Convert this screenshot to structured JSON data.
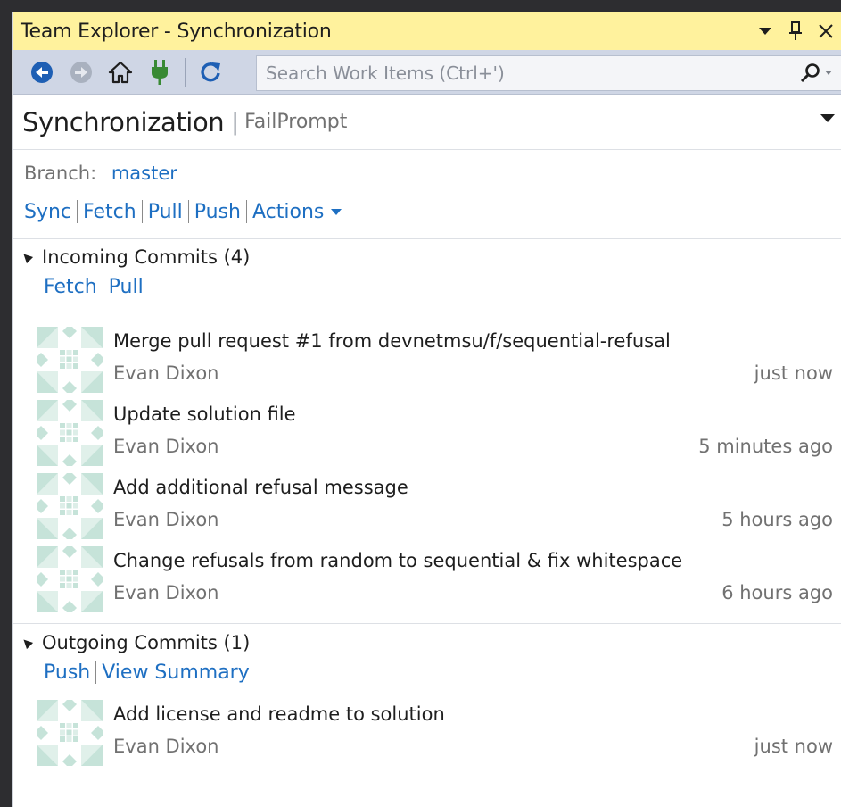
{
  "window": {
    "title": "Team Explorer - Synchronization"
  },
  "toolbar": {
    "search_placeholder": "Search Work Items (Ctrl+')",
    "icons": [
      "back-icon",
      "forward-icon",
      "home-icon",
      "connect-icon",
      "refresh-icon",
      "search-icon"
    ]
  },
  "header": {
    "title": "Synchronization",
    "subtitle": "FailPrompt"
  },
  "branch": {
    "label": "Branch:",
    "value": "master",
    "actions": [
      "Sync",
      "Fetch",
      "Pull",
      "Push",
      "Actions"
    ]
  },
  "incoming": {
    "title": "Incoming Commits (4)",
    "actions": [
      "Fetch",
      "Pull"
    ],
    "commits": [
      {
        "message": "Merge pull request #1 from devnetmsu/f/sequential-refusal",
        "author": "Evan Dixon",
        "time": "just now"
      },
      {
        "message": "Update solution file",
        "author": "Evan Dixon",
        "time": "5 minutes ago"
      },
      {
        "message": "Add additional refusal message",
        "author": "Evan Dixon",
        "time": "5 hours ago"
      },
      {
        "message": "Change refusals from random to sequential & fix whitespace",
        "author": "Evan Dixon",
        "time": "6 hours ago"
      }
    ]
  },
  "outgoing": {
    "title": "Outgoing Commits (1)",
    "actions": [
      "Push",
      "View Summary"
    ],
    "commits": [
      {
        "message": "Add license and readme to solution",
        "author": "Evan Dixon",
        "time": "just now"
      }
    ]
  },
  "colors": {
    "title_bar": "#fff29d",
    "toolbar": "#cfd6e5",
    "link": "#1e6fc2",
    "avatar": "#c6e3d9"
  }
}
